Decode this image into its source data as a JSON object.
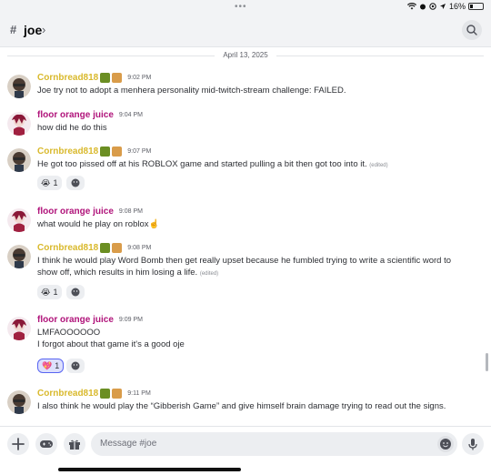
{
  "status_bar": {
    "battery": "16%"
  },
  "header": {
    "channel_icon": "hash-threads-icon",
    "channel_name": "joe"
  },
  "date_divider": "April 13, 2025",
  "messages": [
    {
      "author": "Cornbread818",
      "time": "9:02 PM",
      "text": "Joe try not to adopt a menhera personality mid-twitch-stream challenge: FAILED."
    },
    {
      "author": "floor orange juice",
      "time": "9:04 PM",
      "text": "how did he do this"
    },
    {
      "author": "Cornbread818",
      "time": "9:07 PM",
      "text": "He got too pissed off at his ROBLOX game and started pulling a bit then got too into it.",
      "edited": "(edited)",
      "reaction": {
        "emoji": "😭",
        "count": "1"
      }
    },
    {
      "author": "floor orange juice",
      "time": "9:08 PM",
      "text": "what would he play on roblox☝️"
    },
    {
      "author": "Cornbread818",
      "time": "9:08 PM",
      "text_line1": "I think he would play Word Bomb then get really upset because he fumbled trying to write a scientific word to",
      "text_line2": "show off, which results in him losing a life.",
      "edited": "(edited)",
      "reaction": {
        "emoji": "😭",
        "count": "1"
      }
    },
    {
      "author": "floor orange juice",
      "time": "9:09 PM",
      "text_line1": "LMFAOOOOOO",
      "text_line2": "I forgot about that game it's a good oje",
      "reaction": {
        "emoji": "💖",
        "count": "1"
      }
    },
    {
      "author": "Cornbread818",
      "time": "9:11 PM",
      "text": "I also think he would play the “Gibberish Game” and give himself brain damage trying to read out the signs."
    }
  ],
  "composer": {
    "placeholder": "Message #joe"
  },
  "colors": {
    "cornbread": "#d9b92c",
    "floor_orange_juice": "#b0137a",
    "accent": "#5865f2"
  }
}
